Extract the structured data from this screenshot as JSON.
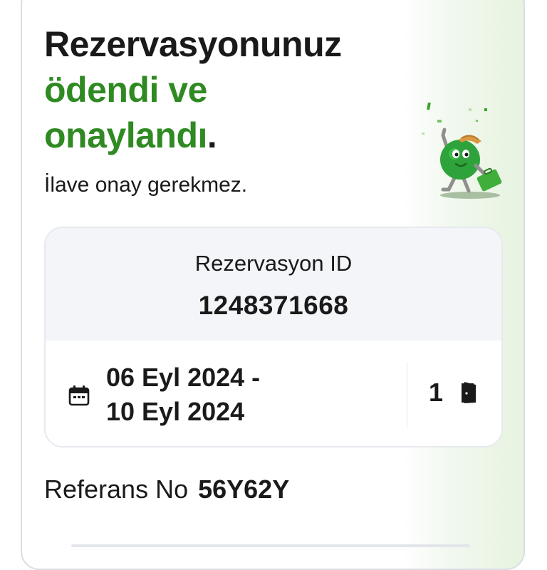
{
  "headline": {
    "line1": "Rezervasyonunuz",
    "line2_green": "ödendi ve",
    "line3_green": "onaylandı",
    "line3_period": "."
  },
  "subtitle": "İlave onay gerekmez.",
  "reservation": {
    "id_label": "Rezervasyon ID",
    "id_value": "1248371668",
    "date_start": "06 Eyl 2024 -",
    "date_end": "10 Eyl 2024",
    "room_count": "1"
  },
  "reference": {
    "label": "Referans No",
    "value": "56Y62Y"
  },
  "icons": {
    "calendar": "calendar-icon",
    "door": "door-icon",
    "mascot": "mascot-illustration"
  },
  "colors": {
    "accent_green": "#2f8a22",
    "text": "#1a1a1a",
    "card_header_bg": "#f3f5f8"
  }
}
